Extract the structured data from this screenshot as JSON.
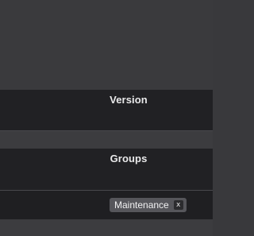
{
  "panel": {
    "sections": {
      "version": {
        "title": "Version"
      },
      "groups": {
        "title": "Groups",
        "tags": [
          {
            "label": "Maintenance",
            "remove_label": "x",
            "remove_icon": "close-icon"
          }
        ]
      }
    }
  }
}
